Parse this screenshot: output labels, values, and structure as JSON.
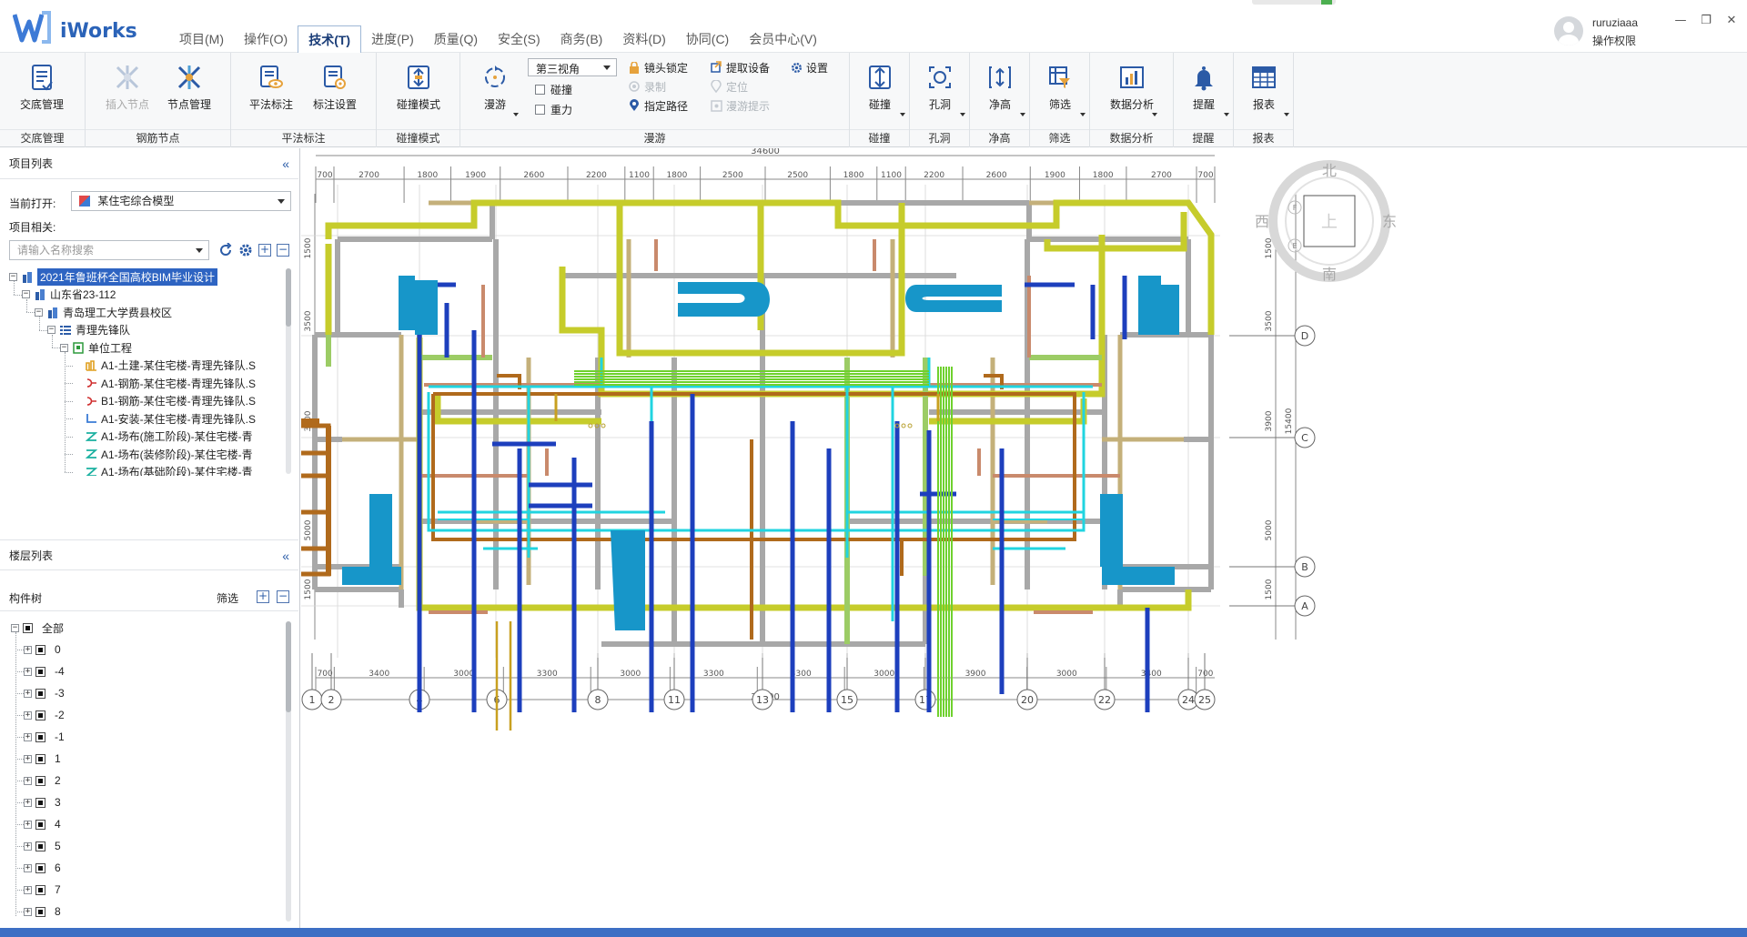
{
  "app": {
    "name": "iWorks"
  },
  "menu": [
    {
      "label": "项目(M)",
      "active": false
    },
    {
      "label": "操作(O)",
      "active": false
    },
    {
      "label": "技术(T)",
      "active": true
    },
    {
      "label": "进度(P)",
      "active": false
    },
    {
      "label": "质量(Q)",
      "active": false
    },
    {
      "label": "安全(S)",
      "active": false
    },
    {
      "label": "商务(B)",
      "active": false
    },
    {
      "label": "资料(D)",
      "active": false
    },
    {
      "label": "协同(C)",
      "active": false
    },
    {
      "label": "会员中心(V)",
      "active": false
    }
  ],
  "user": {
    "name": "ruruziaaa",
    "role": "操作权限"
  },
  "window_controls": {
    "minimize": "—",
    "restore": "❐",
    "close": "✕"
  },
  "ribbon": {
    "groups": {
      "handover": "交底管理",
      "rebar_node": "钢筋节点",
      "plan_annotation": "平法标注",
      "collision_mode": "碰撞模式",
      "roam": "漫游",
      "collision": "碰撞",
      "hole": "孔洞",
      "clearance": "净高",
      "filter": "筛选",
      "data_analysis": "数据分析",
      "remind": "提醒",
      "report": "报表"
    },
    "buttons": {
      "handover_manage": "交底管理",
      "insert_node": "插入节点",
      "node_manage": "节点管理",
      "plan_annotation": "平法标注",
      "annotation_settings": "标注设置",
      "collision_mode": "碰撞模式",
      "roam": "漫游",
      "collision": "碰撞",
      "hole": "孔洞",
      "clearance": "净高",
      "filter": "筛选",
      "data_analysis": "数据分析",
      "remind": "提醒",
      "report": "报表"
    },
    "roam": {
      "view_select": "第三视角",
      "collision_check": "碰撞",
      "gravity_check": "重力",
      "lens_lock": "镜头锁定",
      "record": "录制",
      "specify_path": "指定路径",
      "extract_device": "提取设备",
      "locate": "定位",
      "roam_hint": "漫游提示",
      "settings": "设置"
    }
  },
  "project_panel": {
    "title": "项目列表",
    "collapse": "«",
    "current_open_label": "当前打开:",
    "current_open_value": "某住宅综合模型",
    "related_label": "项目相关:",
    "search_placeholder": "请输入名称搜索",
    "tree": [
      {
        "label": "2021年鲁班杯全国高校BIM毕业设计",
        "level": 0,
        "selected": true,
        "icon": "building-icon"
      },
      {
        "label": "山东省23-112",
        "level": 1,
        "icon": "building-icon"
      },
      {
        "label": "青岛理工大学费县校区",
        "level": 2,
        "icon": "building-icon"
      },
      {
        "label": "青理先锋队",
        "level": 3,
        "icon": "list-icon"
      },
      {
        "label": "单位工程",
        "level": 4,
        "icon": "unit-icon"
      },
      {
        "label": "A1-土建-某住宅楼-青理先锋队.S",
        "level": 5,
        "icon": "civil-icon",
        "color": "#e0a020"
      },
      {
        "label": "A1-钢筋-某住宅楼-青理先锋队.S",
        "level": 5,
        "icon": "rebar-icon",
        "color": "#d03030"
      },
      {
        "label": "B1-钢筋-某住宅楼-青理先锋队.S",
        "level": 5,
        "icon": "rebar-icon",
        "color": "#d03030"
      },
      {
        "label": "A1-安装-某住宅楼-青理先锋队.S",
        "level": 5,
        "icon": "install-icon",
        "color": "#3a7bd5"
      },
      {
        "label": "A1-场布(施工阶段)-某住宅楼-青",
        "level": 5,
        "icon": "site-icon",
        "color": "#1ab0a0"
      },
      {
        "label": "A1-场布(装修阶段)-某住宅楼-青",
        "level": 5,
        "icon": "site-icon",
        "color": "#1ab0a0"
      },
      {
        "label": "A1-场布(基础阶段)-某住宅楼-青",
        "level": 5,
        "icon": "site-icon",
        "color": "#1ab0a0"
      }
    ]
  },
  "floor_panel": {
    "title": "楼层列表",
    "collapse": "«",
    "tree_label": "构件树",
    "filter_label": "筛选",
    "expand_all": "+",
    "collapse_all": "−",
    "root": "全部",
    "floors": [
      "0",
      "-4",
      "-3",
      "-2",
      "-1",
      "1",
      "2",
      "3",
      "4",
      "5",
      "6",
      "7",
      "8"
    ]
  },
  "drawing": {
    "top_total": "34600",
    "bottom_total": "34600",
    "top_dims": [
      "700",
      "2700",
      "1800",
      "1900",
      "2600",
      "2200",
      "1100",
      "1800",
      "2500",
      "2500",
      "1800",
      "1100",
      "2200",
      "2600",
      "1900",
      "1800",
      "2700",
      "700"
    ],
    "bottom_dims": [
      "700",
      "3400",
      "3000",
      "3300",
      "3000",
      "3300",
      "3300",
      "3000",
      "3900",
      "3000",
      "3400",
      "700"
    ],
    "left_dims": [
      "1500",
      "3500",
      "3900",
      "5000",
      "1500"
    ],
    "right_dims": [
      "1500",
      "3500",
      "3900",
      "5000",
      "1500"
    ],
    "right_total": "15400",
    "axis_cols": [
      "1",
      "2",
      "4",
      "6",
      "8",
      "11",
      "13",
      "15",
      "17",
      "20",
      "22",
      "24",
      "25"
    ],
    "axis_rows": [
      "D",
      "C",
      "B",
      "A"
    ],
    "compass": {
      "north": "北",
      "south": "南",
      "east": "东",
      "west": "西",
      "top": "上",
      "front": "F",
      "east_face": "E"
    }
  },
  "colors": {
    "accent": "#2b63b8",
    "selection": "#2e64c2",
    "wall_gray": "#a8a8a8",
    "pipe_yellow": "#c6cc2b",
    "pipe_green": "#9ccc65",
    "pipe_blue": "#1d3fbd",
    "pipe_cyan": "#21d4e0",
    "duct_blue": "#1796c9",
    "pipe_brown": "#b06a1c",
    "pipe_salmon": "#c98a6c",
    "pipe_tan": "#c4b07a",
    "gas_green": "#6fd12e",
    "bottom_bar": "#3d6fc4"
  }
}
